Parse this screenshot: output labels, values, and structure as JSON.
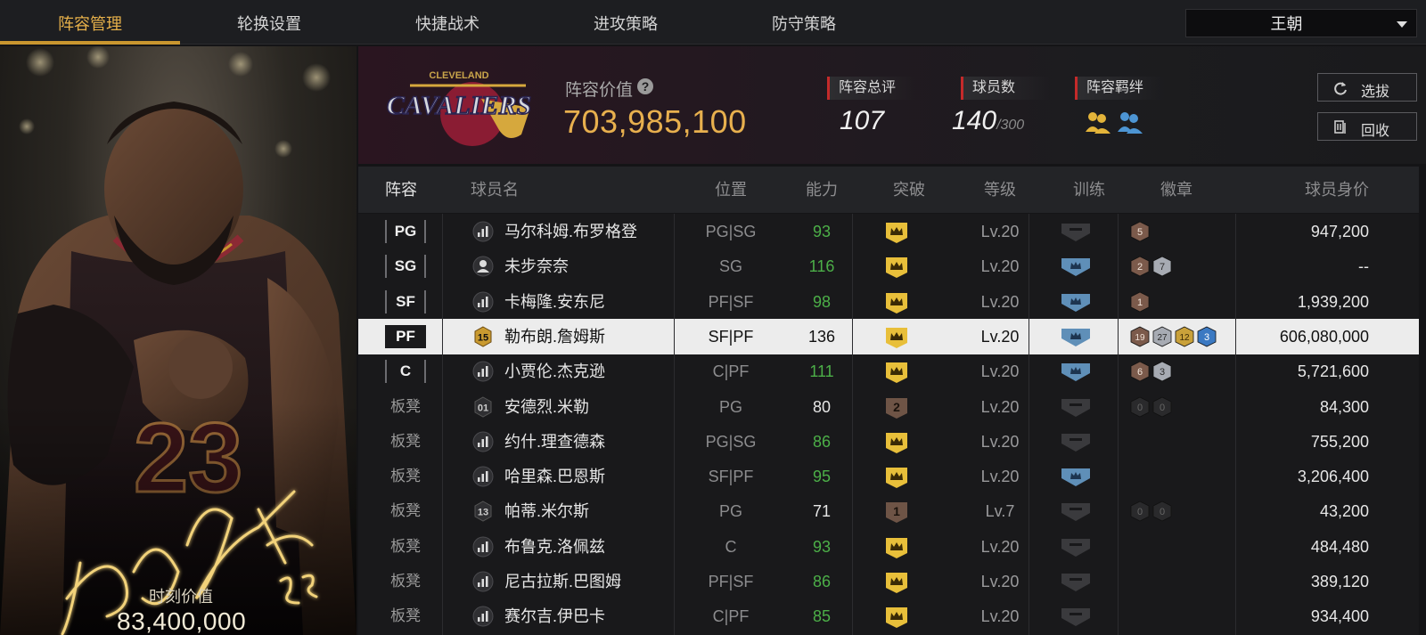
{
  "nav": {
    "tabs": [
      {
        "label": "阵容管理",
        "active": true
      },
      {
        "label": "轮换设置",
        "active": false
      },
      {
        "label": "快捷战术",
        "active": false
      },
      {
        "label": "进攻策略",
        "active": false
      },
      {
        "label": "防守策略",
        "active": false
      }
    ],
    "team_select": "王朝"
  },
  "card": {
    "value_label": "时刻价值",
    "value": "83,400,000",
    "jersey_number": "23"
  },
  "header": {
    "team_logo_text": "CAVALIERS",
    "team_logo_subtext": "CLEVELAND",
    "lineup_value_label": "阵容价值",
    "help_icon": "?",
    "lineup_value": "703,985,100",
    "overall_label": "阵容总评",
    "overall_value": "107",
    "players_label": "球员数",
    "players_value": "140",
    "players_max": "/300",
    "bond_label": "阵容羁绊",
    "draft_button": "选拔",
    "recycle_button": "回收"
  },
  "table": {
    "columns": [
      "阵容",
      "球员名",
      "位置",
      "能力",
      "突破",
      "等级",
      "训练",
      "徽章",
      "球员身价"
    ],
    "rows": [
      {
        "slot": "PG",
        "icon": "stats-icon",
        "name": "马尔科姆.布罗格登",
        "position": "PG|SG",
        "ability": "93",
        "ability_color": "green",
        "breakthrough": "crown",
        "level": "Lv.20",
        "training": "none",
        "badges": [
          {
            "tier": "bronze",
            "n": "5"
          }
        ],
        "value": "947,200"
      },
      {
        "slot": "SG",
        "icon": "person-icon",
        "name": "未步奈奈",
        "position": "SG",
        "ability": "116",
        "ability_color": "green",
        "breakthrough": "crown",
        "level": "Lv.20",
        "training": "blue",
        "badges": [
          {
            "tier": "bronze",
            "n": "2"
          },
          {
            "tier": "silver",
            "n": "7"
          }
        ],
        "value": "--"
      },
      {
        "slot": "SF",
        "icon": "stats-icon",
        "name": "卡梅隆.安东尼",
        "position": "PF|SF",
        "ability": "98",
        "ability_color": "green",
        "breakthrough": "crown",
        "level": "Lv.20",
        "training": "blue",
        "badges": [
          {
            "tier": "bronze",
            "n": "1"
          }
        ],
        "value": "1,939,200"
      },
      {
        "slot": "PF",
        "icon": "number-icon",
        "icon_text": "15",
        "name": "勒布朗.詹姆斯",
        "position": "SF|PF",
        "ability": "136",
        "ability_color": "white",
        "breakthrough": "crown",
        "level": "Lv.20",
        "training": "blue",
        "badges": [
          {
            "tier": "bronze",
            "n": "19"
          },
          {
            "tier": "silver",
            "n": "27"
          },
          {
            "tier": "gold",
            "n": "12"
          },
          {
            "tier": "blue",
            "n": "3"
          }
        ],
        "value": "606,080,000",
        "selected": true
      },
      {
        "slot": "C",
        "icon": "stats-icon",
        "name": "小贾伦.杰克逊",
        "position": "C|PF",
        "ability": "111",
        "ability_color": "green",
        "breakthrough": "crown",
        "level": "Lv.20",
        "training": "blue",
        "badges": [
          {
            "tier": "bronze",
            "n": "6"
          },
          {
            "tier": "silver",
            "n": "3"
          }
        ],
        "value": "5,721,600"
      },
      {
        "slot": "板凳",
        "icon": "number-icon",
        "icon_text": "01",
        "name": "安德烈.米勒",
        "position": "PG",
        "ability": "80",
        "ability_color": "white",
        "breakthrough": "2",
        "level": "Lv.20",
        "training": "none",
        "badges": [
          {
            "tier": "dark",
            "n": "0"
          },
          {
            "tier": "dark",
            "n": "0"
          }
        ],
        "value": "84,300"
      },
      {
        "slot": "板凳",
        "icon": "stats-icon",
        "name": "约什.理查德森",
        "position": "PG|SG",
        "ability": "86",
        "ability_color": "green",
        "breakthrough": "crown",
        "level": "Lv.20",
        "training": "none",
        "badges": [],
        "value": "755,200"
      },
      {
        "slot": "板凳",
        "icon": "stats-icon",
        "name": "哈里森.巴恩斯",
        "position": "SF|PF",
        "ability": "95",
        "ability_color": "green",
        "breakthrough": "crown",
        "level": "Lv.20",
        "training": "blue",
        "badges": [],
        "value": "3,206,400"
      },
      {
        "slot": "板凳",
        "icon": "number-icon",
        "icon_text": "13",
        "name": "帕蒂.米尔斯",
        "position": "PG",
        "ability": "71",
        "ability_color": "white",
        "breakthrough": "1",
        "level": "Lv.7",
        "training": "none",
        "badges": [
          {
            "tier": "dark",
            "n": "0"
          },
          {
            "tier": "dark",
            "n": "0"
          }
        ],
        "value": "43,200"
      },
      {
        "slot": "板凳",
        "icon": "stats-icon",
        "name": "布鲁克.洛佩兹",
        "position": "C",
        "ability": "93",
        "ability_color": "green",
        "breakthrough": "crown",
        "level": "Lv.20",
        "training": "none",
        "badges": [],
        "value": "484,480"
      },
      {
        "slot": "板凳",
        "icon": "stats-icon",
        "name": "尼古拉斯.巴图姆",
        "position": "PF|SF",
        "ability": "86",
        "ability_color": "green",
        "breakthrough": "crown",
        "level": "Lv.20",
        "training": "none",
        "badges": [],
        "value": "389,120"
      },
      {
        "slot": "板凳",
        "icon": "stats-icon",
        "name": "赛尔吉.伊巴卡",
        "position": "C|PF",
        "ability": "85",
        "ability_color": "green",
        "breakthrough": "crown",
        "level": "Lv.20",
        "training": "none",
        "badges": [],
        "value": "934,400"
      }
    ]
  },
  "colors": {
    "accent_gold": "#e6b04a",
    "ability_green": "#4caf48",
    "header_red_marker": "#c42a2a",
    "training_blue": "#5f8fb8"
  }
}
